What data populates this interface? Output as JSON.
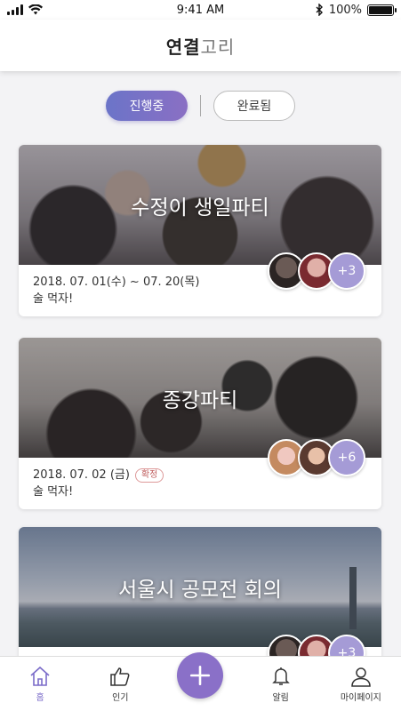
{
  "status_bar": {
    "time": "9:41 AM",
    "battery": "100%",
    "battery_level": 1.0
  },
  "header": {
    "title_bold": "연결",
    "title_light": "고리"
  },
  "tabs": [
    {
      "label": "진행중",
      "active": true
    },
    {
      "label": "완료됨",
      "active": false
    }
  ],
  "cards": [
    {
      "title": "수정이 생일파티",
      "date": "2018. 07. 01(수) ~ 07. 20(목)",
      "badge": "",
      "description": "술 먹자!",
      "more_count": "+3"
    },
    {
      "title": "종강파티",
      "date": "2018. 07. 02 (금)",
      "badge": "확정",
      "description": "술 먹자!",
      "more_count": "+6"
    },
    {
      "title": "서울시 공모전 회의",
      "date": "",
      "badge": "",
      "description": "",
      "more_count": "+3"
    }
  ],
  "bottom_nav": [
    {
      "label": "홈",
      "icon": "home-icon",
      "active": true
    },
    {
      "label": "인기",
      "icon": "thumbs-up-icon",
      "active": false
    },
    {
      "label": "",
      "icon": "plus-icon",
      "active": false
    },
    {
      "label": "알림",
      "icon": "bell-icon",
      "active": false
    },
    {
      "label": "마이페이지",
      "icon": "person-icon",
      "active": false
    }
  ],
  "colors": {
    "accent": "#8a70c8",
    "tab_active_start": "#6b74c8",
    "tab_active_end": "#8a6fc4",
    "badge": "#c06060"
  }
}
